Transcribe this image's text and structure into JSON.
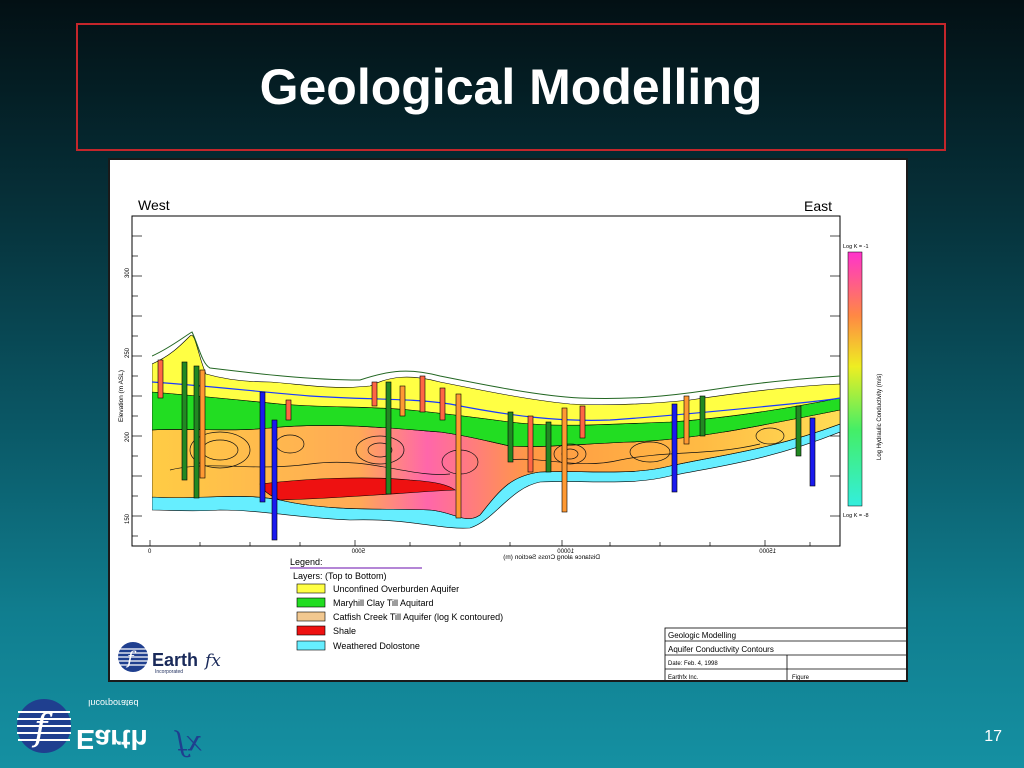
{
  "slide": {
    "title": "Geological Modelling",
    "page_number": "17"
  },
  "figure": {
    "west_label": "West",
    "east_label": "East",
    "y_axis_label": "Elevation (m ASL)",
    "y_ticks": [
      "300",
      "250",
      "200",
      "150"
    ],
    "x_axis_label": "Distance along Cross Section (m)",
    "x_ticks": [
      "0",
      "5000",
      "10000",
      "15000"
    ],
    "colorbar": {
      "top_label": "Log K = -1",
      "bottom_label": "Log K = -8",
      "title": "Log Hydraulic Conductivity (m/s)"
    },
    "legend": {
      "heading": "Legend:",
      "subheading": "Layers: (Top to Bottom)",
      "items": [
        {
          "label": "Unconfined Overburden Aquifer",
          "color": "#ffff44"
        },
        {
          "label": "Maryhill Clay Till Aquitard",
          "color": "#22dd22"
        },
        {
          "label": "Catfish Creek Till Aquifer (log K contoured)",
          "color": "#f2c890"
        },
        {
          "label": "Shale",
          "color": "#ee1111"
        },
        {
          "label": "Weathered Dolostone",
          "color": "#66eeff"
        }
      ]
    },
    "logo": {
      "brand": "Earth",
      "suffix": "fx",
      "tag": "Incorporated"
    },
    "title_block": {
      "row1": "Geologic Modelling",
      "row2": "Aquifer Conductivity Contours",
      "row3": "Date: Feb. 4, 1998",
      "row4a": "Earthfx Inc.",
      "row4b": "Figure"
    }
  },
  "bottom_logo": {
    "brand": "Earth",
    "suffix": "fx",
    "tag": "Incorporated"
  }
}
